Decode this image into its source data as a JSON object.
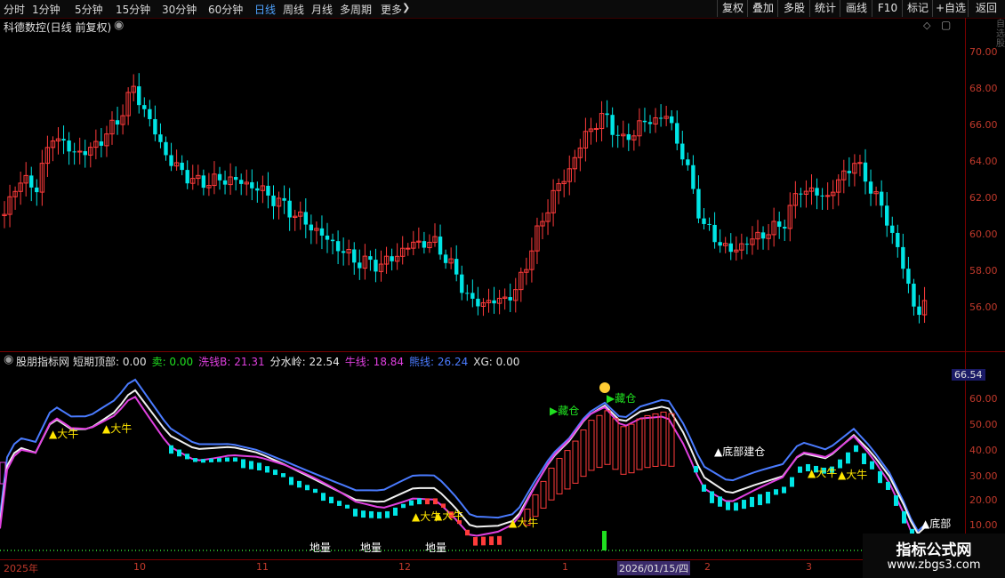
{
  "toolbar": {
    "timeframes": [
      "分时",
      "1分钟",
      "5分钟",
      "15分钟",
      "30分钟",
      "60分钟",
      "日线",
      "周线",
      "月线",
      "多周期",
      "更多"
    ],
    "more_icon": "chevron-right-icon",
    "buttons": [
      "复权",
      "叠加",
      "多股",
      "统计",
      "画线",
      "F10",
      "标记",
      "+自选",
      "返回"
    ]
  },
  "stock": {
    "title": "科德数控(日线 前复权)"
  },
  "price_axis": {
    "ticks": [
      "70.00",
      "68.00",
      "66.00",
      "64.00",
      "62.00",
      "60.00",
      "58.00",
      "56.00"
    ]
  },
  "indicator": {
    "name": "股朋指标网",
    "values": [
      {
        "label": "短期顶部:",
        "value": "0.00",
        "color": "#e0e0e0"
      },
      {
        "label": "卖:",
        "value": "0.00",
        "color": "#20e020"
      },
      {
        "label": "洗钱B:",
        "value": "21.31",
        "color": "#e040e0"
      },
      {
        "label": "分水岭:",
        "value": "22.54",
        "color": "#e8e8e8"
      },
      {
        "label": "牛线:",
        "value": "18.84",
        "color": "#e040e0"
      },
      {
        "label": "熊线:",
        "value": "26.24",
        "color": "#4a7bff"
      },
      {
        "label": "XG:",
        "value": "0.00",
        "color": "#e0e0e0"
      }
    ],
    "axis_ticks": [
      "60.00",
      "50.00",
      "40.00",
      "30.00",
      "20.00",
      "10.00"
    ],
    "current": "66.54"
  },
  "annotations": {
    "bull": "大牛",
    "cellar": "地量",
    "bottom_build": "底部建仓",
    "hide": "藏仓",
    "bottom": "底部"
  },
  "date_axis": {
    "labels": [
      "2025年",
      "10",
      "11",
      "12",
      "1",
      "2026/01/15/四",
      "2",
      "3"
    ]
  },
  "side_text": "自选股",
  "watermark": {
    "title": "指标公式网",
    "url": "www.zbgs3.com"
  }
}
